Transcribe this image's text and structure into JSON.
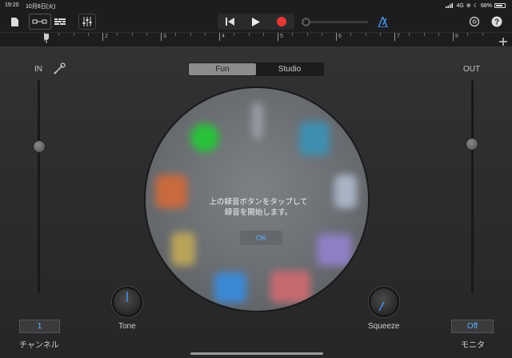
{
  "status_bar": {
    "time": "19:20",
    "date": "10月6日(火)",
    "network": "4G",
    "battery": "68%"
  },
  "toolbar": {
    "icons": [
      "my-songs-icon",
      "view-icon",
      "tracks-icon",
      "mixer-icon",
      "rewind-icon",
      "play-icon",
      "record-icon",
      "metronome-icon",
      "settings-icon",
      "help-icon"
    ],
    "record_color": "#e53935",
    "metronome_color": "#4a90e2"
  },
  "ruler": {
    "marks": [
      "1",
      "2",
      "3",
      "4",
      "5",
      "6",
      "7",
      "8"
    ]
  },
  "input": {
    "label": "IN",
    "channel_value": "1",
    "channel_label": "チャンネル"
  },
  "output": {
    "label": "OUT",
    "monitor_value": "Off",
    "monitor_label": "モニタ"
  },
  "mode_switch": {
    "options": [
      "Fun",
      "Studio"
    ],
    "selected": "Fun"
  },
  "dialog": {
    "line1": "上の録音ボタンをタップして",
    "line2": "録音を開始します。",
    "ok_label": "OK"
  },
  "knobs": {
    "tone_label": "Tone",
    "squeeze_label": "Squeeze"
  }
}
